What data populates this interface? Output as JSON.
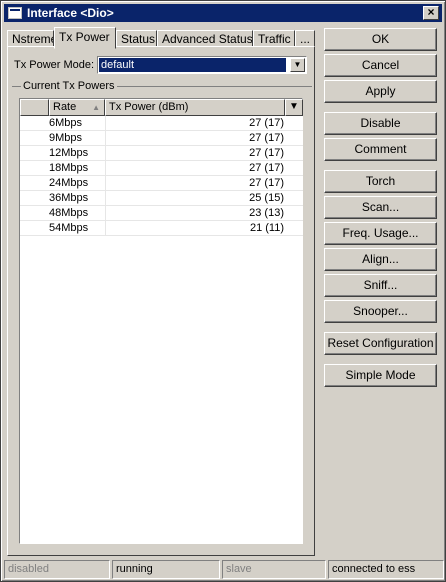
{
  "window": {
    "title": "Interface <Dio>",
    "close_label": "×"
  },
  "tabs": [
    {
      "label": "Nstreme"
    },
    {
      "label": "Tx Power"
    },
    {
      "label": "Status"
    },
    {
      "label": "Advanced Status"
    },
    {
      "label": "Traffic"
    },
    {
      "label": "..."
    }
  ],
  "tx_power_mode": {
    "label": "Tx Power Mode:",
    "value": "default"
  },
  "current_tx_powers": {
    "title": "Current Tx Powers",
    "columns": [
      "Rate",
      "Tx Power (dBm)"
    ],
    "rows": [
      {
        "rate": "6Mbps",
        "power": "27 (17)"
      },
      {
        "rate": "9Mbps",
        "power": "27 (17)"
      },
      {
        "rate": "12Mbps",
        "power": "27 (17)"
      },
      {
        "rate": "18Mbps",
        "power": "27 (17)"
      },
      {
        "rate": "24Mbps",
        "power": "27 (17)"
      },
      {
        "rate": "36Mbps",
        "power": "25 (15)"
      },
      {
        "rate": "48Mbps",
        "power": "23 (13)"
      },
      {
        "rate": "54Mbps",
        "power": "21 (11)"
      }
    ]
  },
  "buttons": {
    "ok": "OK",
    "cancel": "Cancel",
    "apply": "Apply",
    "disable": "Disable",
    "comment": "Comment",
    "torch": "Torch",
    "scan": "Scan...",
    "freq_usage": "Freq. Usage...",
    "align": "Align...",
    "sniff": "Sniff...",
    "snooper": "Snooper...",
    "reset_configuration": "Reset Configuration",
    "simple_mode": "Simple Mode"
  },
  "status": {
    "state": "disabled",
    "run": "running",
    "role": "slave",
    "connection": "connected to ess"
  }
}
